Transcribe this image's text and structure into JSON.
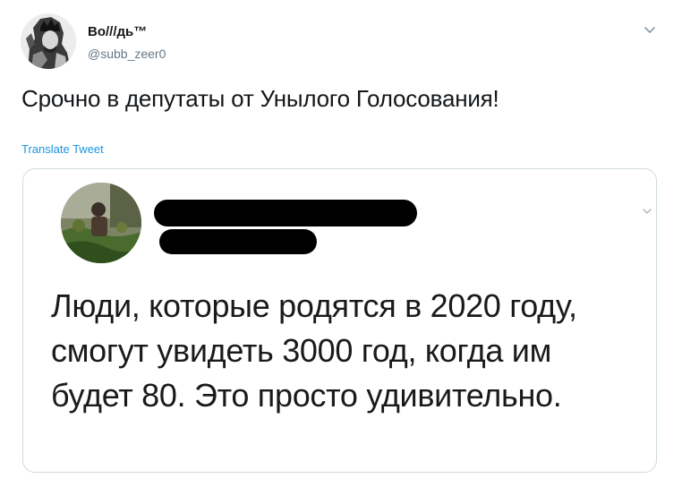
{
  "tweet": {
    "author": {
      "name": "Во///дь™",
      "handle": "@subb_zeer0"
    },
    "text": "Срочно в депутаты от Унылого Голосования!",
    "translate_label": "Translate Tweet",
    "quoted": {
      "text": "Люди, которые родятся в 2020 году, смогут увидеть 3000 год, когда им будет 80. Это просто удивительно."
    }
  },
  "colors": {
    "link": "#1b95e0",
    "handle": "#657786",
    "border": "#cfd9de",
    "redaction": "#000000"
  },
  "icons": {
    "menu": "chevron-down-icon",
    "avatar": "portrait-illustration",
    "quoted_menu": "chevron-down-icon"
  }
}
